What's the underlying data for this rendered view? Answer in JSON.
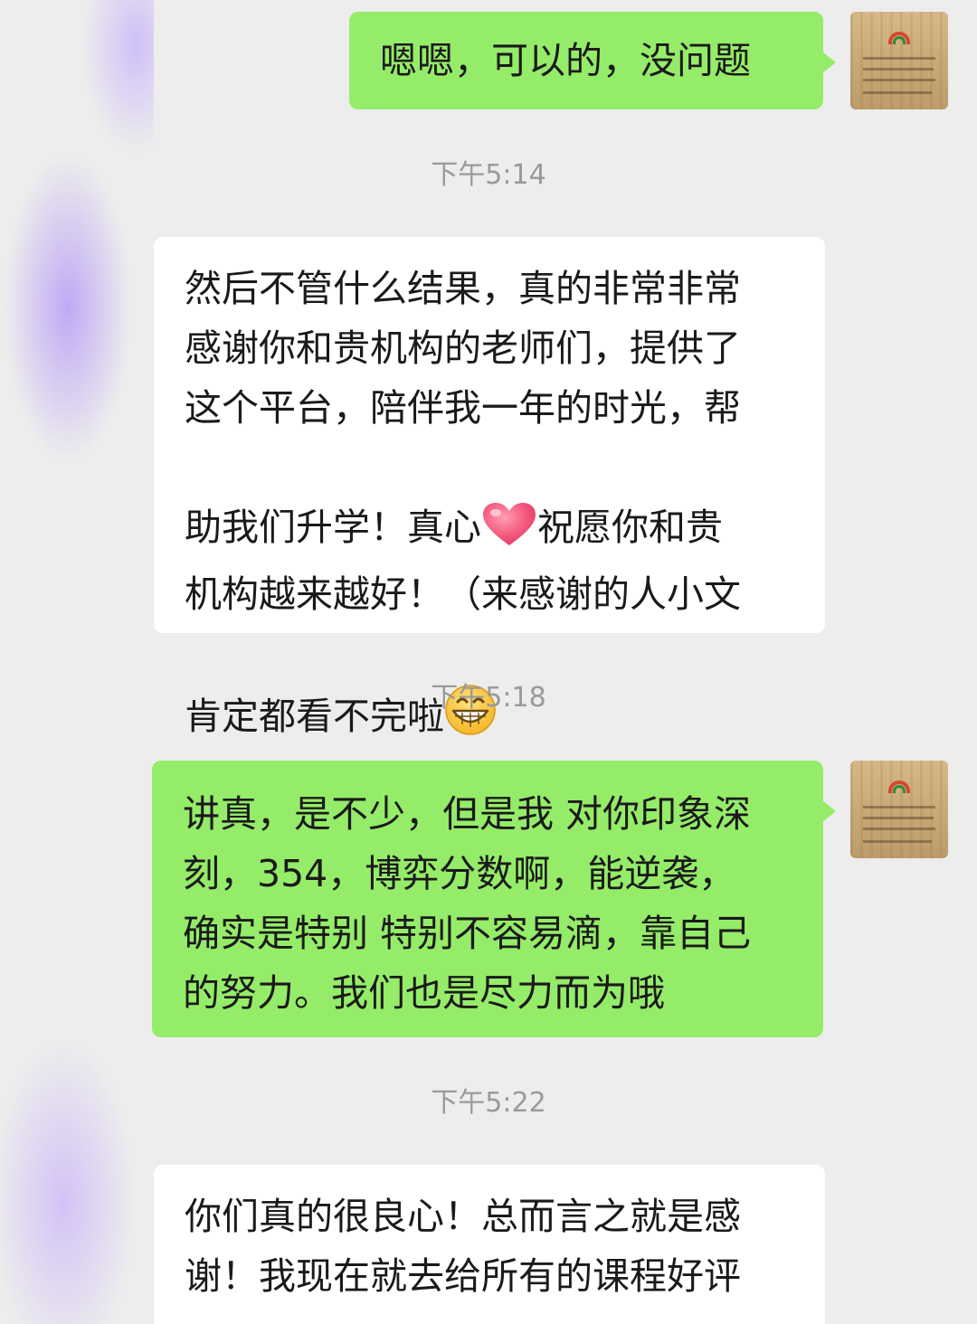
{
  "messages": [
    {
      "type": "sent",
      "text": "嗯嗯，可以的，没问题"
    },
    {
      "type": "timestamp",
      "text": "下午5:14"
    },
    {
      "type": "received",
      "lines": [
        "然后不管什么结果，真的非常非常",
        "感谢你和贵机构的老师们，提供了",
        "这个平台，陪伴我一年的时光，帮",
        "助我们升学！真心",
        "祝愿你和贵",
        "机构越来越好！（来感谢的人小文",
        "肯定都看不完啦",
        "）"
      ]
    },
    {
      "type": "timestamp",
      "text": "下午5:18"
    },
    {
      "type": "sent",
      "lines": [
        "讲真，是不少，但是我 对你印象深",
        "刻，354，博弈分数啊，能逆袭，",
        "确实是特别 特别不容易滴，靠自己",
        "的努力。我们也是尽力而为哦"
      ]
    },
    {
      "type": "timestamp",
      "text": "下午5:22"
    },
    {
      "type": "received",
      "lines": [
        "你们真的很良心！总而言之就是感",
        "谢！我现在就去给所有的课程好评"
      ]
    }
  ],
  "icons": {
    "heart": "heart-emoji-icon",
    "grin": "grinning-emoji-icon",
    "avatar": "org-logo-avatar"
  },
  "colors": {
    "background": "#ededed",
    "sent_bubble": "#95ec69",
    "received_bubble": "#ffffff",
    "timestamp": "#9a9a9a"
  }
}
